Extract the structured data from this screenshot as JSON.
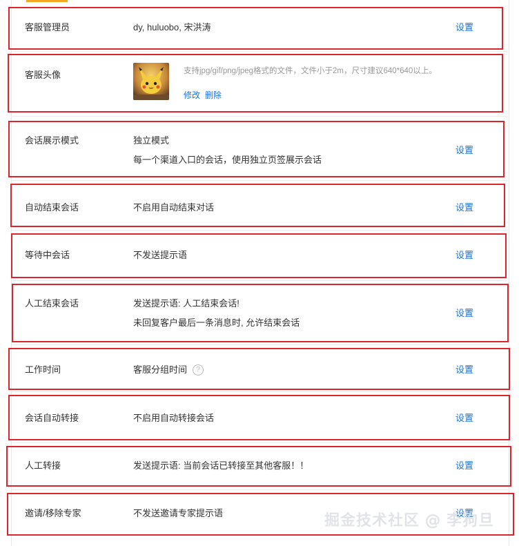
{
  "settings": {
    "rows": [
      {
        "label": "客服管理员",
        "value": "dy, huluobo, 宋洪涛",
        "action": "设置"
      },
      {
        "label": "客服头像",
        "hint": "支持jpg/gif/png/jpeg格式的文件，文件小于2m，尺寸建议640*640以上。",
        "edit": "修改",
        "delete": "删除"
      },
      {
        "label": "会话展示模式",
        "value": "独立模式",
        "value2": "每一个渠道入口的会话，使用独立页签展示会话",
        "action": "设置"
      },
      {
        "label": "自动结束会话",
        "value": "不启用自动结束对话",
        "action": "设置"
      },
      {
        "label": "等待中会话",
        "value": "不发送提示语",
        "action": "设置"
      },
      {
        "label": "人工结束会话",
        "value": "发送提示语: 人工结束会话!",
        "value2": "未回复客户最后一条消息时, 允许结束会话",
        "action": "设置"
      },
      {
        "label": "工作时间",
        "value": "客服分组时间",
        "action": "设置",
        "help_icon": "question-circle-icon"
      },
      {
        "label": "会话自动转接",
        "value": "不启用自动转接会话",
        "action": "设置"
      },
      {
        "label": "人工转接",
        "value": "发送提示语: 当前会话已转接至其他客服！！",
        "action": "设置"
      },
      {
        "label": "邀请/移除专家",
        "value": "不发送邀请专家提示语",
        "action": "设置"
      }
    ]
  },
  "watermark": "掘金技术社区 @ 李狗旦",
  "colors": {
    "link": "#1a73d6",
    "highlight_box": "#d9262c",
    "accent": "#f5a623"
  }
}
